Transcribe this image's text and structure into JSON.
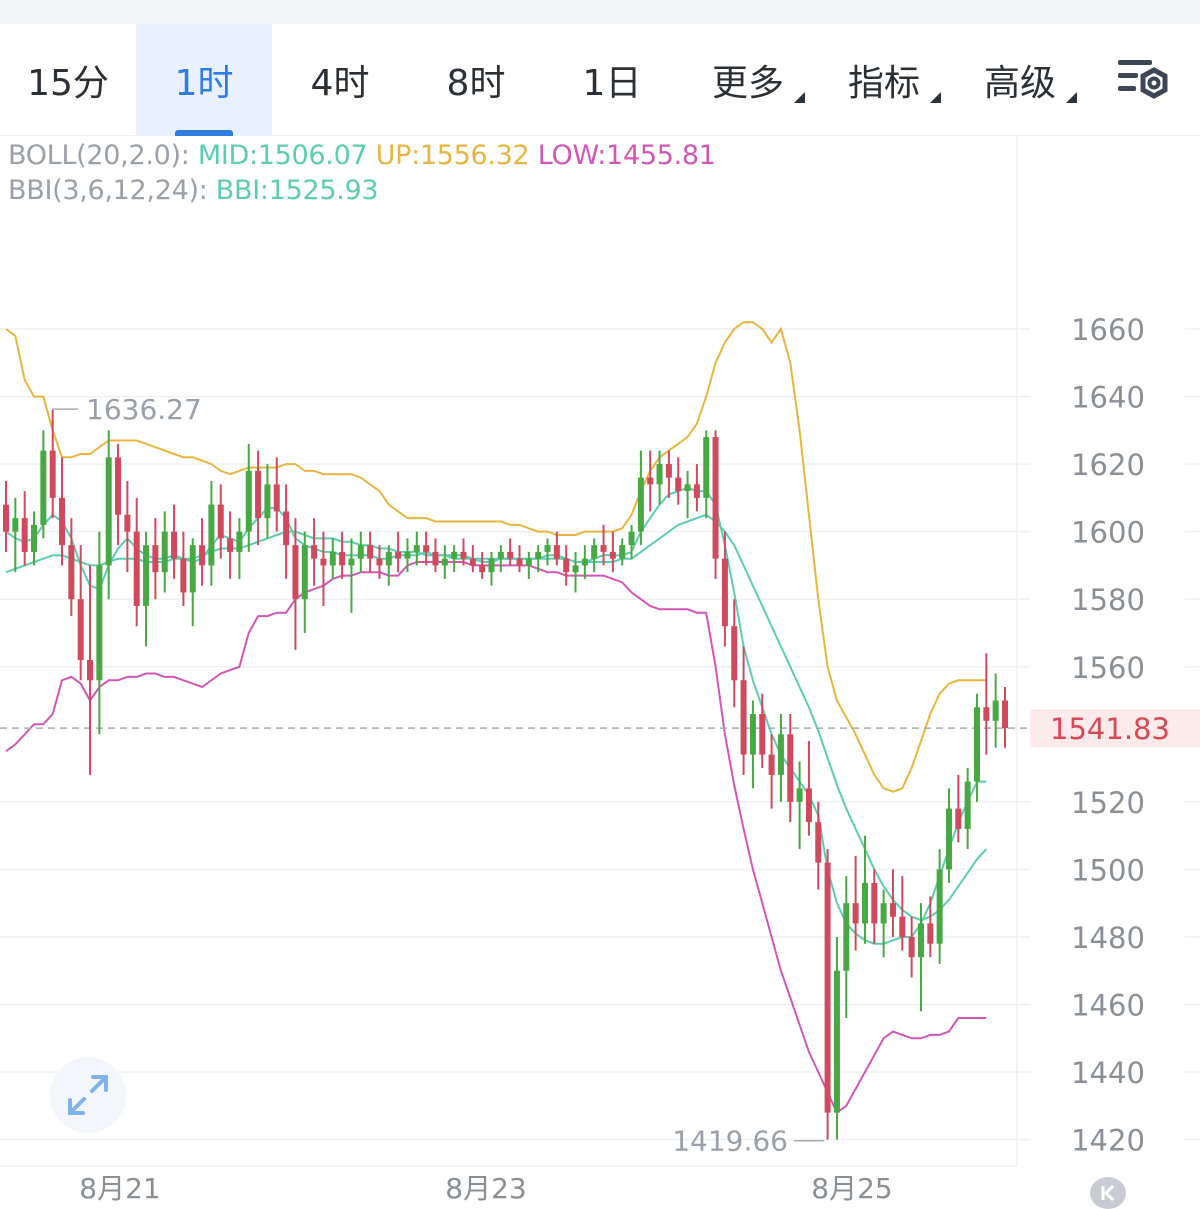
{
  "tabs": [
    {
      "label": "15分",
      "active": false,
      "dropdown": false
    },
    {
      "label": "1时",
      "active": true,
      "dropdown": false
    },
    {
      "label": "4时",
      "active": false,
      "dropdown": false
    },
    {
      "label": "8时",
      "active": false,
      "dropdown": false
    },
    {
      "label": "1日",
      "active": false,
      "dropdown": false
    },
    {
      "label": "更多",
      "active": false,
      "dropdown": true
    },
    {
      "label": "指标",
      "active": false,
      "dropdown": true
    },
    {
      "label": "高级",
      "active": false,
      "dropdown": true
    }
  ],
  "legend": {
    "boll_label": "BOLL(20,2.0):",
    "boll_mid": "MID:1506.07",
    "boll_up": "UP:1556.32",
    "boll_low": "LOW:1455.81",
    "bbi_label": "BBI(3,6,12,24):",
    "bbi_value": "BBI:1525.93"
  },
  "colors": {
    "accent": "#2f7de1",
    "up_candle": "#48a844",
    "down_candle": "#cf4a5c",
    "mid_line": "#5ccdb0",
    "up_line": "#e8b540",
    "low_line": "#d257b5",
    "current_price": "#d64a56"
  },
  "icons": {
    "settings": "chart-settings-icon",
    "expand": "expand-arrows-icon",
    "nav": "collapse-left-icon"
  },
  "chart_data": {
    "type": "candlestick",
    "y_axis": {
      "min": 1410,
      "max": 1675,
      "ticks": [
        1660,
        1640,
        1620,
        1600,
        1580,
        1560,
        1520,
        1500,
        1480,
        1460,
        1440,
        1420
      ],
      "position": "right"
    },
    "x_axis": {
      "labels": [
        "8月21",
        "8月23",
        "8月25"
      ]
    },
    "current_price": "1541.83",
    "max_annotation": "1636.27",
    "min_annotation": "1419.66",
    "grid": true,
    "ohlc": [
      [
        1608,
        1615,
        1594,
        1600
      ],
      [
        1600,
        1610,
        1588,
        1604
      ],
      [
        1604,
        1612,
        1590,
        1594
      ],
      [
        1594,
        1606,
        1590,
        1602
      ],
      [
        1602,
        1630,
        1598,
        1624
      ],
      [
        1624,
        1636,
        1604,
        1610
      ],
      [
        1610,
        1622,
        1590,
        1596
      ],
      [
        1596,
        1604,
        1575,
        1580
      ],
      [
        1580,
        1596,
        1556,
        1562
      ],
      [
        1562,
        1590,
        1528,
        1556
      ],
      [
        1556,
        1600,
        1540,
        1590
      ],
      [
        1590,
        1630,
        1580,
        1622
      ],
      [
        1622,
        1626,
        1596,
        1605
      ],
      [
        1605,
        1615,
        1588,
        1600
      ],
      [
        1600,
        1610,
        1572,
        1578
      ],
      [
        1578,
        1600,
        1566,
        1596
      ],
      [
        1596,
        1604,
        1580,
        1588
      ],
      [
        1588,
        1606,
        1582,
        1600
      ],
      [
        1600,
        1608,
        1586,
        1592
      ],
      [
        1592,
        1600,
        1578,
        1582
      ],
      [
        1582,
        1598,
        1572,
        1596
      ],
      [
        1596,
        1604,
        1584,
        1590
      ],
      [
        1590,
        1615,
        1584,
        1608
      ],
      [
        1608,
        1614,
        1592,
        1598
      ],
      [
        1598,
        1606,
        1586,
        1594
      ],
      [
        1594,
        1604,
        1586,
        1600
      ],
      [
        1600,
        1626,
        1594,
        1618
      ],
      [
        1618,
        1624,
        1596,
        1604
      ],
      [
        1604,
        1620,
        1598,
        1614
      ],
      [
        1614,
        1622,
        1600,
        1606
      ],
      [
        1606,
        1614,
        1586,
        1596
      ],
      [
        1596,
        1604,
        1565,
        1580
      ],
      [
        1580,
        1600,
        1570,
        1596
      ],
      [
        1596,
        1604,
        1584,
        1592
      ],
      [
        1592,
        1600,
        1578,
        1590
      ],
      [
        1590,
        1598,
        1586,
        1594
      ],
      [
        1594,
        1600,
        1586,
        1590
      ],
      [
        1590,
        1598,
        1576,
        1592
      ],
      [
        1592,
        1600,
        1588,
        1596
      ],
      [
        1596,
        1600,
        1588,
        1592
      ],
      [
        1592,
        1596,
        1586,
        1590
      ],
      [
        1590,
        1596,
        1584,
        1594
      ],
      [
        1594,
        1600,
        1588,
        1592
      ],
      [
        1592,
        1598,
        1588,
        1594
      ],
      [
        1594,
        1600,
        1590,
        1596
      ],
      [
        1596,
        1600,
        1590,
        1594
      ],
      [
        1594,
        1598,
        1588,
        1590
      ],
      [
        1590,
        1596,
        1586,
        1592
      ],
      [
        1592,
        1596,
        1588,
        1594
      ],
      [
        1594,
        1598,
        1590,
        1592
      ],
      [
        1592,
        1596,
        1588,
        1590
      ],
      [
        1590,
        1594,
        1586,
        1588
      ],
      [
        1588,
        1594,
        1584,
        1592
      ],
      [
        1592,
        1596,
        1588,
        1594
      ],
      [
        1594,
        1598,
        1590,
        1592
      ],
      [
        1592,
        1596,
        1588,
        1590
      ],
      [
        1590,
        1594,
        1586,
        1592
      ],
      [
        1592,
        1596,
        1588,
        1594
      ],
      [
        1594,
        1598,
        1590,
        1596
      ],
      [
        1596,
        1600,
        1590,
        1592
      ],
      [
        1592,
        1596,
        1584,
        1588
      ],
      [
        1588,
        1594,
        1582,
        1590
      ],
      [
        1590,
        1596,
        1586,
        1592
      ],
      [
        1592,
        1598,
        1588,
        1596
      ],
      [
        1596,
        1602,
        1590,
        1594
      ],
      [
        1594,
        1600,
        1588,
        1592
      ],
      [
        1592,
        1598,
        1590,
        1596
      ],
      [
        1596,
        1602,
        1592,
        1600
      ],
      [
        1600,
        1624,
        1596,
        1616
      ],
      [
        1616,
        1624,
        1606,
        1614
      ],
      [
        1614,
        1624,
        1608,
        1620
      ],
      [
        1620,
        1624,
        1610,
        1616
      ],
      [
        1616,
        1622,
        1608,
        1612
      ],
      [
        1612,
        1618,
        1604,
        1614
      ],
      [
        1614,
        1620,
        1606,
        1610
      ],
      [
        1610,
        1630,
        1604,
        1628
      ],
      [
        1628,
        1630,
        1586,
        1592
      ],
      [
        1592,
        1600,
        1566,
        1572
      ],
      [
        1572,
        1580,
        1548,
        1556
      ],
      [
        1556,
        1566,
        1528,
        1534
      ],
      [
        1534,
        1550,
        1524,
        1546
      ],
      [
        1546,
        1552,
        1530,
        1534
      ],
      [
        1534,
        1540,
        1518,
        1528
      ],
      [
        1528,
        1546,
        1520,
        1540
      ],
      [
        1540,
        1546,
        1514,
        1520
      ],
      [
        1520,
        1532,
        1506,
        1524
      ],
      [
        1524,
        1538,
        1510,
        1514
      ],
      [
        1514,
        1520,
        1494,
        1502
      ],
      [
        1502,
        1506,
        1420,
        1428
      ],
      [
        1428,
        1480,
        1420,
        1470
      ],
      [
        1470,
        1498,
        1456,
        1490
      ],
      [
        1490,
        1504,
        1476,
        1484
      ],
      [
        1484,
        1510,
        1478,
        1496
      ],
      [
        1496,
        1500,
        1478,
        1484
      ],
      [
        1484,
        1494,
        1474,
        1490
      ],
      [
        1490,
        1500,
        1480,
        1486
      ],
      [
        1486,
        1498,
        1476,
        1480
      ],
      [
        1480,
        1486,
        1468,
        1474
      ],
      [
        1474,
        1490,
        1458,
        1484
      ],
      [
        1484,
        1492,
        1474,
        1478
      ],
      [
        1478,
        1506,
        1472,
        1500
      ],
      [
        1500,
        1524,
        1496,
        1518
      ],
      [
        1518,
        1528,
        1508,
        1512
      ],
      [
        1512,
        1530,
        1506,
        1526
      ],
      [
        1526,
        1552,
        1520,
        1548
      ],
      [
        1548,
        1564,
        1534,
        1544
      ],
      [
        1544,
        1558,
        1536,
        1550
      ],
      [
        1550,
        1554,
        1536,
        1541.83
      ]
    ],
    "series": [
      {
        "name": "MID",
        "values": [
          1588,
          1589,
          1590,
          1591,
          1592,
          1593,
          1593,
          1592,
          1591,
          1590,
          1590,
          1591,
          1592,
          1592,
          1592,
          1591,
          1591,
          1591,
          1592,
          1592,
          1592,
          1593,
          1594,
          1595,
          1595,
          1595,
          1596,
          1597,
          1598,
          1599,
          1600,
          1600,
          1599,
          1598,
          1598,
          1598,
          1597,
          1597,
          1596,
          1596,
          1595,
          1595,
          1594,
          1594,
          1594,
          1593,
          1593,
          1593,
          1593,
          1593,
          1592,
          1592,
          1592,
          1592,
          1592,
          1592,
          1592,
          1592,
          1592,
          1592,
          1592,
          1591,
          1591,
          1591,
          1591,
          1591,
          1592,
          1592,
          1594,
          1596,
          1598,
          1600,
          1602,
          1603,
          1604,
          1605,
          1603,
          1600,
          1596,
          1590,
          1584,
          1578,
          1572,
          1566,
          1560,
          1554,
          1548,
          1541,
          1533,
          1525,
          1518,
          1512,
          1506,
          1500,
          1495,
          1491,
          1488,
          1486,
          1485,
          1486,
          1488,
          1491,
          1495,
          1499,
          1503,
          1506
        ]
      },
      {
        "name": "UP",
        "values": [
          1660,
          1658,
          1645,
          1640,
          1640,
          1630,
          1622,
          1622,
          1623,
          1623,
          1625,
          1627,
          1627,
          1627,
          1627,
          1626,
          1625,
          1624,
          1623,
          1622,
          1622,
          1621,
          1620,
          1618,
          1617,
          1618,
          1619,
          1619,
          1619,
          1619,
          1620,
          1620,
          1618,
          1618,
          1617,
          1617,
          1617,
          1617,
          1616,
          1614,
          1612,
          1608,
          1606,
          1604,
          1604,
          1604,
          1603,
          1603,
          1603,
          1603,
          1603,
          1603,
          1603,
          1603,
          1602,
          1602,
          1601,
          1600,
          1600,
          1599,
          1599,
          1599,
          1600,
          1600,
          1600,
          1600,
          1601,
          1605,
          1612,
          1618,
          1622,
          1624,
          1626,
          1628,
          1632,
          1640,
          1650,
          1656,
          1660,
          1662,
          1662,
          1660,
          1656,
          1660,
          1650,
          1630,
          1605,
          1580,
          1560,
          1550,
          1545,
          1540,
          1534,
          1528,
          1524,
          1523,
          1524,
          1530,
          1538,
          1546,
          1552,
          1555,
          1556,
          1556,
          1556,
          1556
        ]
      },
      {
        "name": "LOW",
        "values": [
          1535,
          1537,
          1540,
          1543,
          1543,
          1546,
          1556,
          1557,
          1555,
          1550,
          1554,
          1556,
          1556,
          1557,
          1557,
          1558,
          1558,
          1557,
          1557,
          1556,
          1555,
          1554,
          1556,
          1558,
          1559,
          1560,
          1570,
          1575,
          1575,
          1576,
          1576,
          1580,
          1582,
          1583,
          1584,
          1586,
          1587,
          1587,
          1588,
          1588,
          1588,
          1587,
          1587,
          1590,
          1591,
          1591,
          1591,
          1591,
          1591,
          1591,
          1590,
          1590,
          1590,
          1590,
          1590,
          1590,
          1590,
          1589,
          1588,
          1588,
          1587,
          1587,
          1587,
          1587,
          1587,
          1586,
          1585,
          1582,
          1580,
          1578,
          1577,
          1577,
          1577,
          1577,
          1576,
          1576,
          1560,
          1540,
          1525,
          1512,
          1500,
          1490,
          1480,
          1470,
          1462,
          1454,
          1446,
          1440,
          1434,
          1428,
          1430,
          1435,
          1440,
          1445,
          1450,
          1452,
          1451,
          1450,
          1450,
          1451,
          1451,
          1452,
          1456,
          1456,
          1456,
          1456
        ]
      },
      {
        "name": "BBI",
        "values": [
          1600,
          1598,
          1597,
          1598,
          1602,
          1605,
          1603,
          1598,
          1590,
          1584,
          1583,
          1590,
          1595,
          1598,
          1595,
          1593,
          1592,
          1592,
          1593,
          1592,
          1591,
          1592,
          1596,
          1599,
          1598,
          1597,
          1601,
          1604,
          1607,
          1607,
          1604,
          1598,
          1596,
          1595,
          1594,
          1594,
          1593,
          1593,
          1593,
          1593,
          1592,
          1592,
          1593,
          1593,
          1593,
          1594,
          1593,
          1593,
          1592,
          1592,
          1592,
          1591,
          1591,
          1592,
          1592,
          1592,
          1592,
          1592,
          1593,
          1593,
          1592,
          1591,
          1591,
          1592,
          1593,
          1593,
          1593,
          1594,
          1600,
          1604,
          1608,
          1611,
          1612,
          1613,
          1612,
          1612,
          1608,
          1596,
          1582,
          1566,
          1556,
          1548,
          1540,
          1534,
          1530,
          1526,
          1522,
          1516,
          1500,
          1490,
          1484,
          1481,
          1479,
          1478,
          1478,
          1479,
          1480,
          1480,
          1484,
          1490,
          1498,
          1506,
          1514,
          1520,
          1526,
          1526
        ]
      }
    ]
  }
}
